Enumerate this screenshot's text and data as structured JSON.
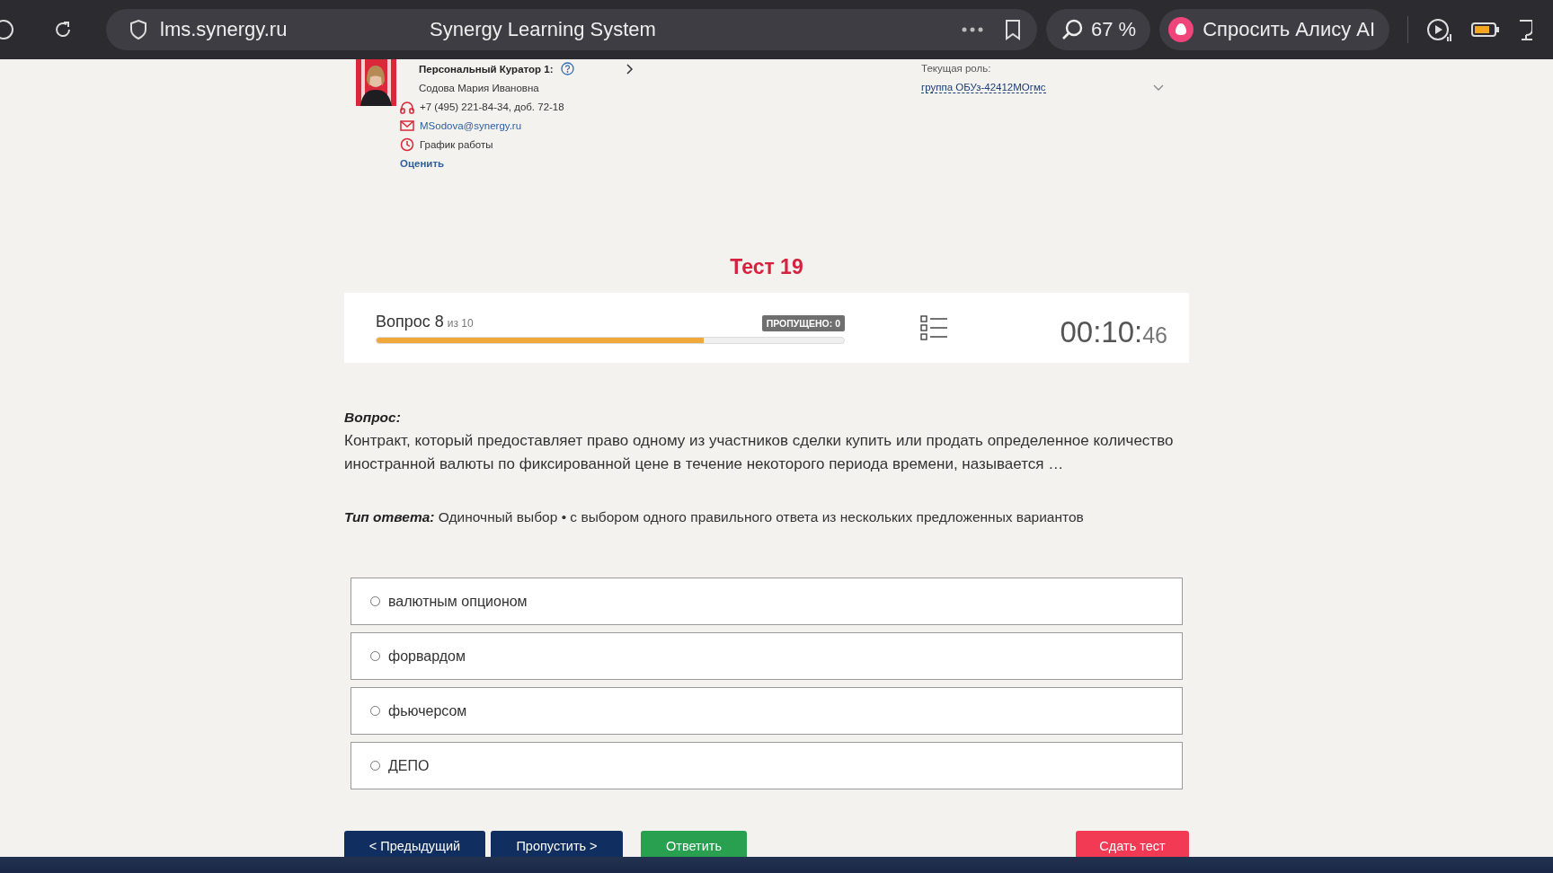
{
  "browser": {
    "address": "lms.synergy.ru",
    "page_title": "Synergy Learning System",
    "zoom": "67 %",
    "assistant_button": "Спросить Алису AI"
  },
  "curator": {
    "heading": "Персональный Куратор 1:",
    "name": "Содова Мария Ивановна",
    "phone": "+7 (495) 221-84-34, доб. 72-18",
    "email": "MSodova@synergy.ru",
    "schedule": "График работы",
    "rate_link": "Оценить"
  },
  "role": {
    "label": "Текущая роль:",
    "value": "группа ОБУз-42412МОгмс"
  },
  "test_title": "Тест 19",
  "progress": {
    "question": "Вопрос 8",
    "of": "из 10",
    "skipped": "ПРОПУЩЕНО: 0",
    "level": 0.7,
    "timer_main": "00:10:",
    "timer_seconds": "46"
  },
  "question": {
    "label": "Вопрос:",
    "text": "Контракт, который предоставляет право одному из участников сделки купить или продать определенное количество иностранной валюты по фиксированной цене в течение некоторого периода времени, называется …",
    "answer_type": "**Тип ответа:** Одиночный выбор • с выбором одного правильного ответа из нескольких предложенных вариантов"
  },
  "options": [
    {
      "label": "валютным опционом",
      "selected": false
    },
    {
      "label": "форвардом",
      "selected": false
    },
    {
      "label": "фьючерсом",
      "selected": false
    },
    {
      "label": "ДЕПО",
      "selected": false
    }
  ],
  "buttons": [
    {
      "label": "< Предыдущий",
      "kind": "secondary"
    },
    {
      "label": "Пропустить >",
      "kind": "secondary"
    },
    {
      "label": "Ответить",
      "kind": "primary"
    },
    {
      "label": "Сдать тест",
      "kind": "danger"
    }
  ]
}
